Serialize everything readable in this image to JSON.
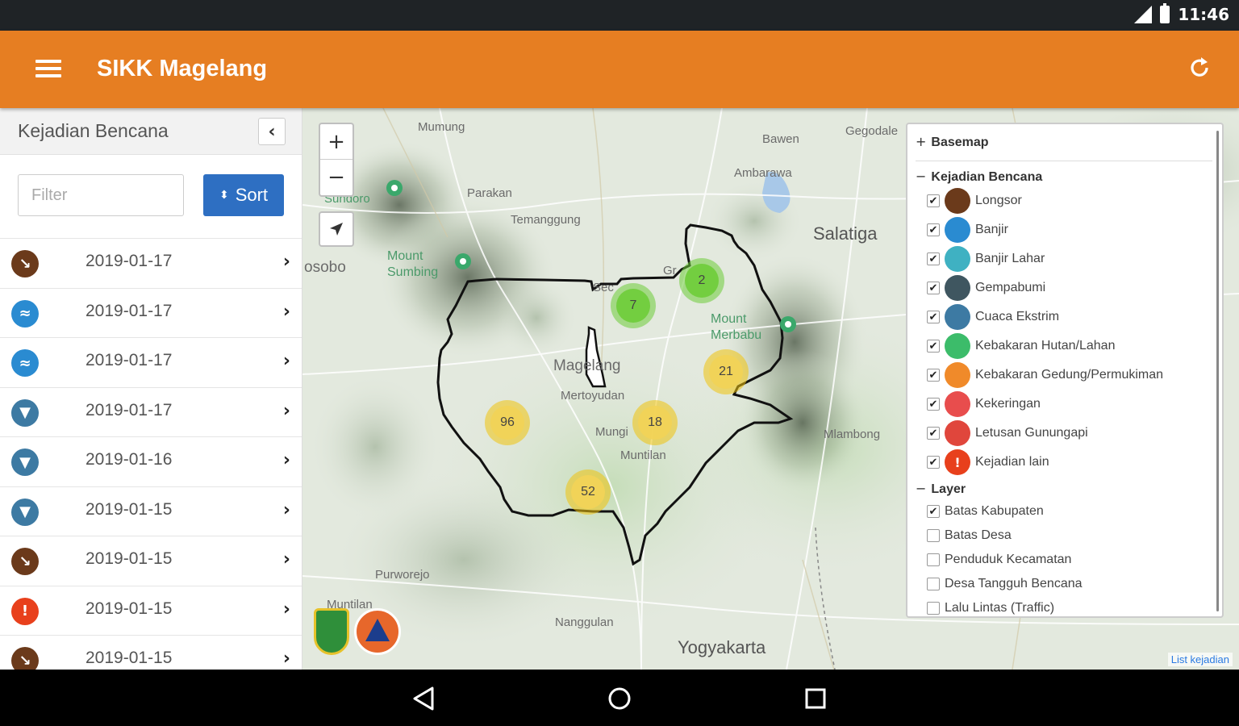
{
  "status_bar": {
    "time": "11:46"
  },
  "app_bar": {
    "title": "SIKK Magelang"
  },
  "sidebar": {
    "title": "Kejadian Bencana",
    "filter_placeholder": "Filter",
    "sort_label": "Sort",
    "events": [
      {
        "date": "2019-01-17",
        "type": "Longsor",
        "color": "#6b3a1b"
      },
      {
        "date": "2019-01-17",
        "type": "Banjir",
        "color": "#2a8bd1"
      },
      {
        "date": "2019-01-17",
        "type": "Banjir",
        "color": "#2a8bd1"
      },
      {
        "date": "2019-01-17",
        "type": "Cuaca Ekstrim",
        "color": "#3d7aa3"
      },
      {
        "date": "2019-01-16",
        "type": "Cuaca Ekstrim",
        "color": "#3d7aa3"
      },
      {
        "date": "2019-01-15",
        "type": "Cuaca Ekstrim",
        "color": "#3d7aa3"
      },
      {
        "date": "2019-01-15",
        "type": "Longsor",
        "color": "#6b3a1b"
      },
      {
        "date": "2019-01-15",
        "type": "Kejadian lain",
        "color": "#e8401c"
      },
      {
        "date": "2019-01-15",
        "type": "Longsor",
        "color": "#6b3a1b"
      }
    ]
  },
  "map": {
    "labels": {
      "mumung": "Mumung",
      "bawen": "Bawen",
      "gegodale": "Gegodale",
      "ambarawa": "Ambarawa",
      "parakan": "Parakan",
      "temanggung": "Temanggung",
      "sundoro": "Sundoro",
      "salatiga": "Salatiga",
      "wonosobo": "osobo",
      "sumbing": "Mount\nSumbing",
      "merbabu": "Mount\nMerbabu",
      "magelang": "Magelang",
      "mertoyudan": "Mertoyudan",
      "mungkid": "Mungi",
      "muntilan": "Muntilan",
      "mlambong": "Mlambong",
      "purworejo": "Purworejo",
      "nanggulan": "Nanggulan",
      "yogyakarta": "Yogyakarta",
      "kmuntilan": "Muntilan",
      "secang": "Sec",
      "grabag": "Gr"
    },
    "clusters": [
      "2",
      "7",
      "21",
      "96",
      "18",
      "52"
    ],
    "zoom_in": "+",
    "zoom_out": "−",
    "attribution": "List kejadian"
  },
  "layer_panel": {
    "basemap_label": "Basemap",
    "basemap_toggle": "+",
    "kejadian_label": "Kejadian Bencana",
    "kejadian_toggle": "−",
    "kejadian_items": [
      {
        "label": "Longsor",
        "checked": true,
        "color": "#6b3a1b"
      },
      {
        "label": "Banjir",
        "checked": true,
        "color": "#2a8bd1"
      },
      {
        "label": "Banjir Lahar",
        "checked": true,
        "color": "#3fb1c2"
      },
      {
        "label": "Gempabumi",
        "checked": true,
        "color": "#3f5660"
      },
      {
        "label": "Cuaca Ekstrim",
        "checked": true,
        "color": "#3d7aa3"
      },
      {
        "label": "Kebakaran Hutan/Lahan",
        "checked": true,
        "color": "#3cbc6a"
      },
      {
        "label": "Kebakaran Gedung/Permukiman",
        "checked": true,
        "color": "#f08a2a"
      },
      {
        "label": "Kekeringan",
        "checked": true,
        "color": "#e84d4d"
      },
      {
        "label": "Letusan Gunungapi",
        "checked": true,
        "color": "#e0463c"
      },
      {
        "label": "Kejadian lain",
        "checked": true,
        "color": "#e8401c"
      }
    ],
    "layer_label": "Layer",
    "layer_toggle": "−",
    "layer_items": [
      {
        "label": "Batas Kabupaten",
        "checked": true
      },
      {
        "label": "Batas Desa",
        "checked": false
      },
      {
        "label": "Penduduk Kecamatan",
        "checked": false
      },
      {
        "label": "Desa Tangguh Bencana",
        "checked": false
      },
      {
        "label": "Lalu Lintas (Traffic)",
        "checked": false
      }
    ]
  },
  "theme": {
    "accent": "#e67e22",
    "sort_button": "#2e6fc2"
  }
}
